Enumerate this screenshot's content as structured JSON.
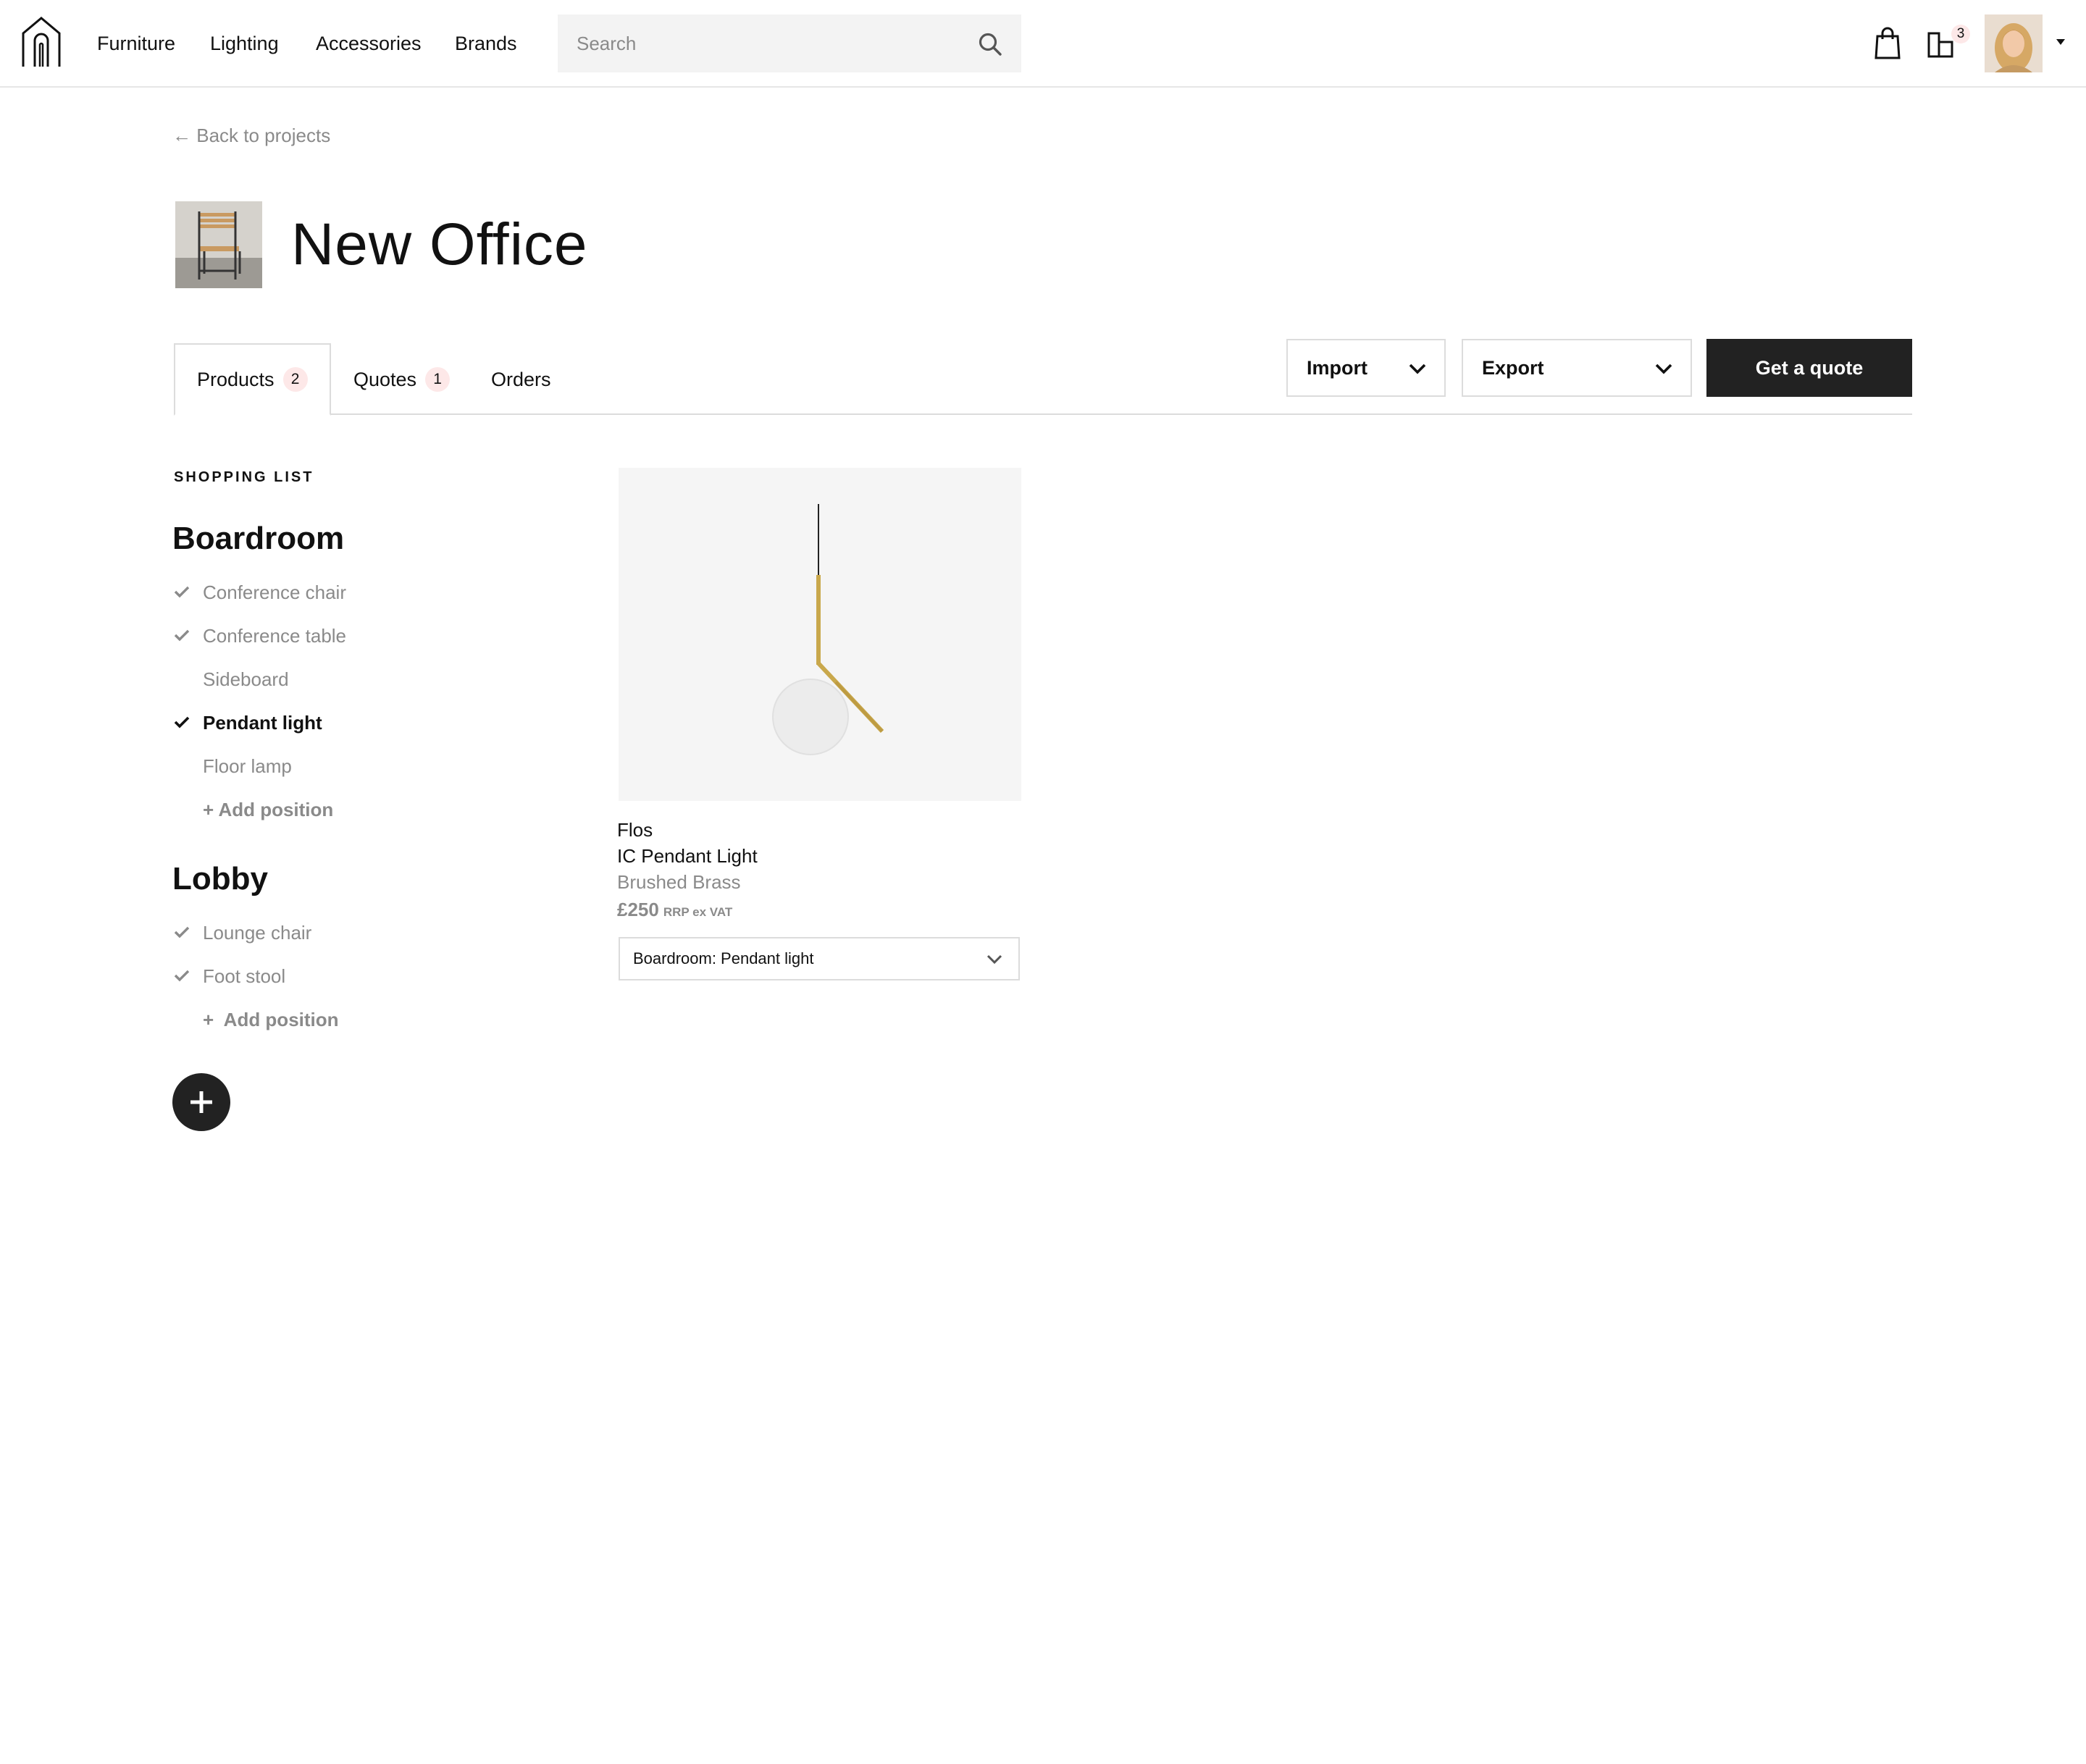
{
  "colors": {
    "text": "#111111",
    "muted": "#8a8a8a",
    "accent_dark": "#222222",
    "badge_bg": "#fde8e8",
    "border": "#dcdcdc",
    "brass": "#c9a84c"
  },
  "nav": {
    "logo_icon": "home-logo-icon",
    "items": [
      {
        "label": "Furniture"
      },
      {
        "label": "Lighting"
      },
      {
        "label": "Accessories"
      },
      {
        "label": "Brands"
      }
    ],
    "search": {
      "placeholder": "Search",
      "icon": "search-icon"
    },
    "cart_icon": "shopping-bag-icon",
    "projects_icon": "projects-icon",
    "projects_count": "3",
    "avatar_icon": "user-avatar",
    "avatar_caret_icon": "caret-down-icon"
  },
  "header": {
    "back_label": "← Back to projects",
    "title": "New Office",
    "thumbnail": "chair-thumbnail"
  },
  "tabs": [
    {
      "label": "Products",
      "count": "2"
    },
    {
      "label": "Quotes",
      "count": "1"
    },
    {
      "label": "Orders"
    }
  ],
  "actions": {
    "import_label": "Import",
    "export_label": "Export",
    "quote_label": "Get a quote"
  },
  "shopping_list": {
    "heading": "SHOPPING LIST",
    "groups": [
      {
        "title": "Boardroom",
        "items": [
          {
            "label": "Conference chair",
            "checked": true
          },
          {
            "label": "Conference table",
            "checked": true
          },
          {
            "label": "Sideboard",
            "checked": false
          },
          {
            "label": "Pendant light",
            "checked": true,
            "current": true
          },
          {
            "label": "Floor lamp",
            "checked": false
          }
        ],
        "add_label": "+ Add position"
      },
      {
        "title": "Lobby",
        "items": [
          {
            "label": "Lounge chair",
            "checked": true
          },
          {
            "label": "Foot stool",
            "checked": true
          }
        ],
        "add_label": "+  Add position"
      }
    ],
    "add_group_icon": "plus-icon"
  },
  "product": {
    "image": "pendant-light-image",
    "brand": "Flos",
    "name": "IC Pendant Light",
    "finish": "Brushed Brass",
    "price": "£250",
    "price_note": "RRP ex VAT",
    "assigned_to": "Boardroom: Pendant light"
  }
}
